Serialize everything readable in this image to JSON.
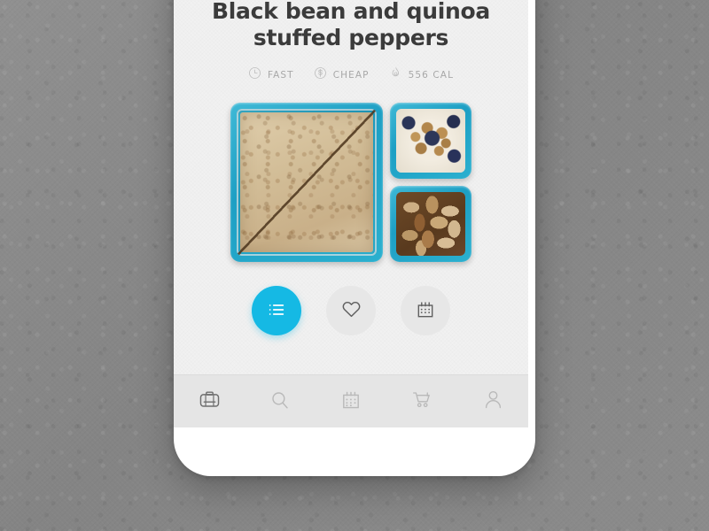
{
  "app": {
    "accent_color": "#15b9e4",
    "screen_bg": "#f1f1f1",
    "tabbar_bg": "#e5e5e5",
    "backdrop_color": "#8a8a8a",
    "title_color": "#3b3b3b",
    "meta_color": "#a8a8a8",
    "icon_color": "#b4b4b4",
    "icon_active_color": "#6e6e6e"
  },
  "recipe": {
    "title": "Black bean and quinoa stuffed peppers",
    "meta": [
      {
        "icon": "clock-icon",
        "label": "FAST"
      },
      {
        "icon": "dollar-circle-icon",
        "label": "CHEAP"
      },
      {
        "icon": "flame-icon",
        "label": "556 CAL"
      }
    ],
    "photo": {
      "name": "bento-box-photo",
      "alt": "Bento lunch box with a diagonally cut sandwich, yogurt with granola and blueberries, and mixed nuts",
      "compartments": [
        {
          "name": "sandwich-compartment",
          "contents": "Diagonally cut whole grain sandwich"
        },
        {
          "name": "yogurt-compartment",
          "contents": "Yogurt with granola and blueberries"
        },
        {
          "name": "nuts-compartment",
          "contents": "Mixed nuts and almonds"
        }
      ]
    }
  },
  "actions": [
    {
      "name": "recipe-steps-button",
      "icon": "list-icon",
      "label": "Recipe steps",
      "active": true
    },
    {
      "name": "favorite-button",
      "icon": "heart-icon",
      "label": "Favorite",
      "active": false
    },
    {
      "name": "schedule-button",
      "icon": "calendar-icon",
      "label": "Schedule",
      "active": false
    }
  ],
  "tabs": [
    {
      "name": "tab-lunchbox",
      "icon": "lunchbox-icon",
      "label": "Lunchbox",
      "active": true
    },
    {
      "name": "tab-search",
      "icon": "search-icon",
      "label": "Search",
      "active": false
    },
    {
      "name": "tab-calendar",
      "icon": "calendar-icon",
      "label": "Calendar",
      "active": false
    },
    {
      "name": "tab-cart",
      "icon": "cart-icon",
      "label": "Cart",
      "active": false
    },
    {
      "name": "tab-profile",
      "icon": "person-icon",
      "label": "Profile",
      "active": false
    }
  ]
}
